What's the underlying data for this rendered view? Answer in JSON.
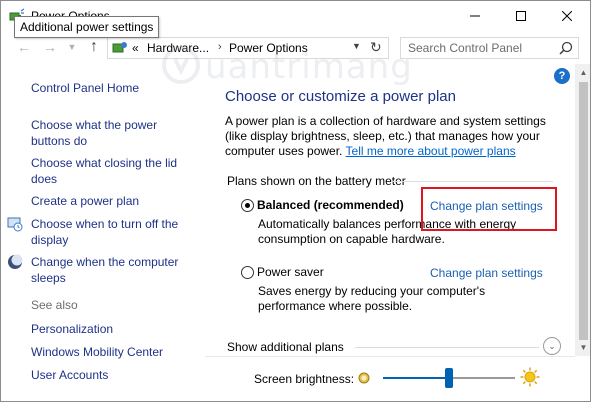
{
  "window": {
    "title": "Power Options",
    "tooltip": "Additional power settings",
    "minimize_icon": "minimize-icon",
    "maximize_icon": "maximize-icon",
    "close_icon": "close-icon"
  },
  "address": {
    "overflow": "«",
    "segments": [
      "Hardware...",
      "Power Options"
    ],
    "search_placeholder": "Search Control Panel"
  },
  "sidebar": {
    "items": [
      {
        "label": "Control Panel Home"
      },
      {
        "label": "Choose what the power buttons do"
      },
      {
        "label": "Choose what closing the lid does"
      },
      {
        "label": "Create a power plan"
      },
      {
        "label": "Choose when to turn off the display",
        "icon": "monitor-clock-icon"
      },
      {
        "label": "Change when the computer sleeps",
        "icon": "moon-icon"
      }
    ],
    "see_also": "See also",
    "see_also_items": [
      {
        "label": "Personalization"
      },
      {
        "label": "Windows Mobility Center"
      },
      {
        "label": "User Accounts"
      }
    ]
  },
  "main": {
    "title": "Choose or customize a power plan",
    "description": "A power plan is a collection of hardware and system settings (like display brightness, sleep, etc.) that manages how your computer uses power.",
    "description_link": "Tell me more about power plans",
    "group_label": "Plans shown on the battery meter",
    "plans": [
      {
        "name": "Balanced (recommended)",
        "selected": true,
        "description": "Automatically balances performance with energy consumption on capable hardware.",
        "link": "Change plan settings"
      },
      {
        "name": "Power saver",
        "selected": false,
        "description": "Saves energy by reducing your computer's performance where possible.",
        "link": "Change plan settings"
      }
    ],
    "show_additional": "Show additional plans"
  },
  "brightness": {
    "label": "Screen brightness:",
    "level_percent": 50
  },
  "colors": {
    "link": "#1e3287",
    "accent": "#0063b1",
    "highlight": "#e0141e"
  },
  "watermark": "uantrimang"
}
